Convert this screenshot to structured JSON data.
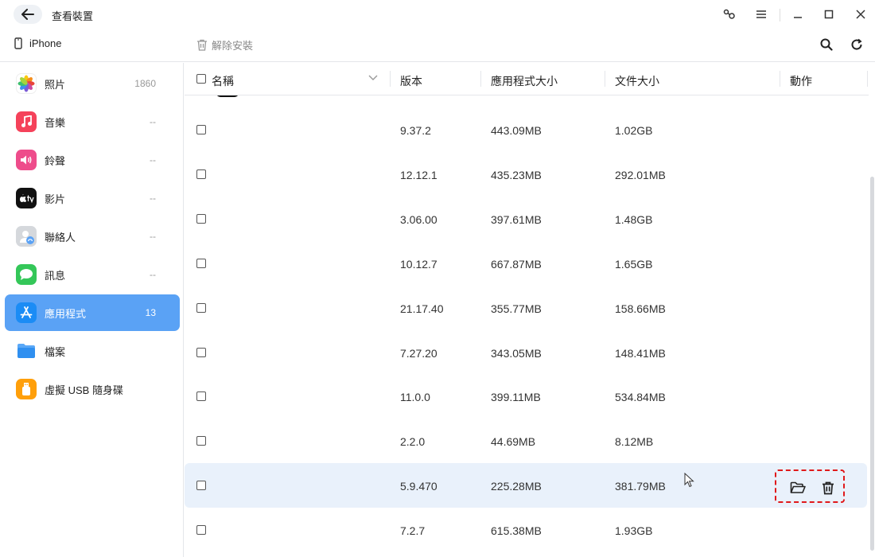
{
  "window": {
    "title": "查看裝置"
  },
  "device": {
    "name": "iPhone"
  },
  "toolbar": {
    "uninstall_label": "解除安裝"
  },
  "sidebar": {
    "items": [
      {
        "label": "照片",
        "count": "1860",
        "icon": "photos-icon",
        "color": "#ffffff"
      },
      {
        "label": "音樂",
        "count": "--",
        "icon": "music-icon",
        "color": "#f5425a"
      },
      {
        "label": "鈴聲",
        "count": "--",
        "icon": "ringtone-icon",
        "color": "#ee4c8b"
      },
      {
        "label": "影片",
        "count": "--",
        "icon": "tv-icon",
        "color": "#111111"
      },
      {
        "label": "聯絡人",
        "count": "--",
        "icon": "contacts-icon",
        "color": "#c9ccd1"
      },
      {
        "label": "訊息",
        "count": "--",
        "icon": "messages-icon",
        "color": "#34c759"
      },
      {
        "label": "應用程式",
        "count": "13",
        "icon": "appstore-icon",
        "color": "#1b8cf5"
      },
      {
        "label": "檔案",
        "count": "",
        "icon": "files-icon",
        "color": "#2f8ff0"
      },
      {
        "label": "虛擬 USB 隨身碟",
        "count": "",
        "icon": "usb-icon",
        "color": "#ff9f0a"
      }
    ]
  },
  "table": {
    "columns": [
      "名稱",
      "版本",
      "應用程式大小",
      "文件大小",
      "動作"
    ],
    "rows": [
      {
        "version": "9.37.2",
        "app_size": "443.09MB",
        "doc_size": "1.02GB"
      },
      {
        "version": "12.12.1",
        "app_size": "435.23MB",
        "doc_size": "292.01MB"
      },
      {
        "version": "3.06.00",
        "app_size": "397.61MB",
        "doc_size": "1.48GB"
      },
      {
        "version": "10.12.7",
        "app_size": "667.87MB",
        "doc_size": "1.65GB"
      },
      {
        "version": "21.17.40",
        "app_size": "355.77MB",
        "doc_size": "158.66MB"
      },
      {
        "version": "7.27.20",
        "app_size": "343.05MB",
        "doc_size": "148.41MB"
      },
      {
        "version": "11.0.0",
        "app_size": "399.11MB",
        "doc_size": "534.84MB"
      },
      {
        "version": "2.2.0",
        "app_size": "44.69MB",
        "doc_size": "8.12MB"
      },
      {
        "version": "5.9.470",
        "app_size": "225.28MB",
        "doc_size": "381.79MB"
      },
      {
        "version": "7.2.7",
        "app_size": "615.38MB",
        "doc_size": "1.93GB"
      }
    ]
  },
  "colors": {
    "accent": "#5aa2f5",
    "highlight_row": "#e9f1fb",
    "annotation": "#e0191b"
  }
}
